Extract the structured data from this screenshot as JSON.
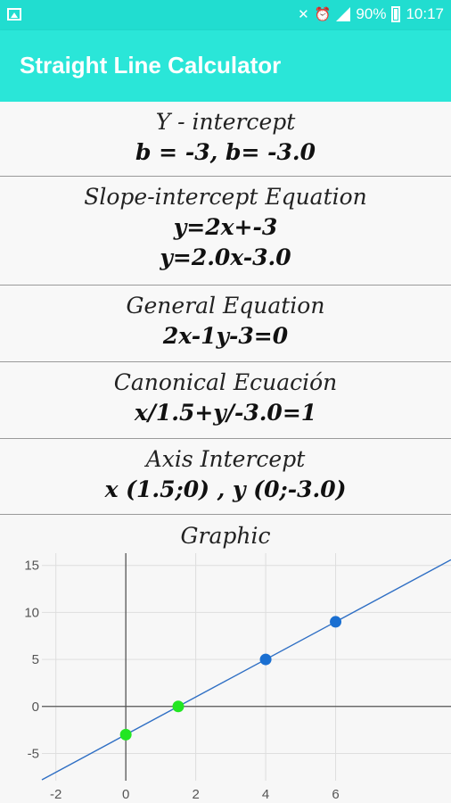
{
  "status_bar": {
    "battery": "90%",
    "time": "10:17",
    "icons": [
      "image-icon",
      "mute-icon",
      "alarm-icon",
      "signal-icon",
      "battery-icon"
    ]
  },
  "app_bar": {
    "title": "Straight Line Calculator",
    "color": "#2ae6d8"
  },
  "sections": [
    {
      "label": "Y - intercept",
      "values": [
        "b = -3, b= -3.0"
      ]
    },
    {
      "label": "Slope-intercept Equation",
      "values": [
        "y=2x+-3",
        "y=2.0x-3.0"
      ]
    },
    {
      "label": "General Equation",
      "values": [
        "2x-1y-3=0"
      ]
    },
    {
      "label": "Canonical Ecuación",
      "values": [
        "x/1.5+y/-3.0=1"
      ]
    },
    {
      "label": "Axis Intercept",
      "values": [
        "x (1.5;0) , y (0;-3.0)"
      ]
    }
  ],
  "graph": {
    "label": "Graphic"
  },
  "chart_data": {
    "type": "line",
    "x_ticks": [
      -2,
      0,
      2,
      4,
      6
    ],
    "y_ticks": [
      -5,
      0,
      5,
      10,
      15
    ],
    "xlim": [
      -2.4,
      9.3
    ],
    "ylim": [
      -7.9,
      16.3
    ],
    "line": {
      "slope": 2,
      "intercept": -3,
      "color": "#2f6fc4"
    },
    "points": [
      {
        "x": 0,
        "y": -3,
        "color": "#22e622"
      },
      {
        "x": 1.5,
        "y": 0,
        "color": "#22e622"
      },
      {
        "x": 4,
        "y": 5,
        "color": "#1a6fd1"
      },
      {
        "x": 6,
        "y": 9,
        "color": "#1a6fd1"
      }
    ],
    "grid": true
  }
}
